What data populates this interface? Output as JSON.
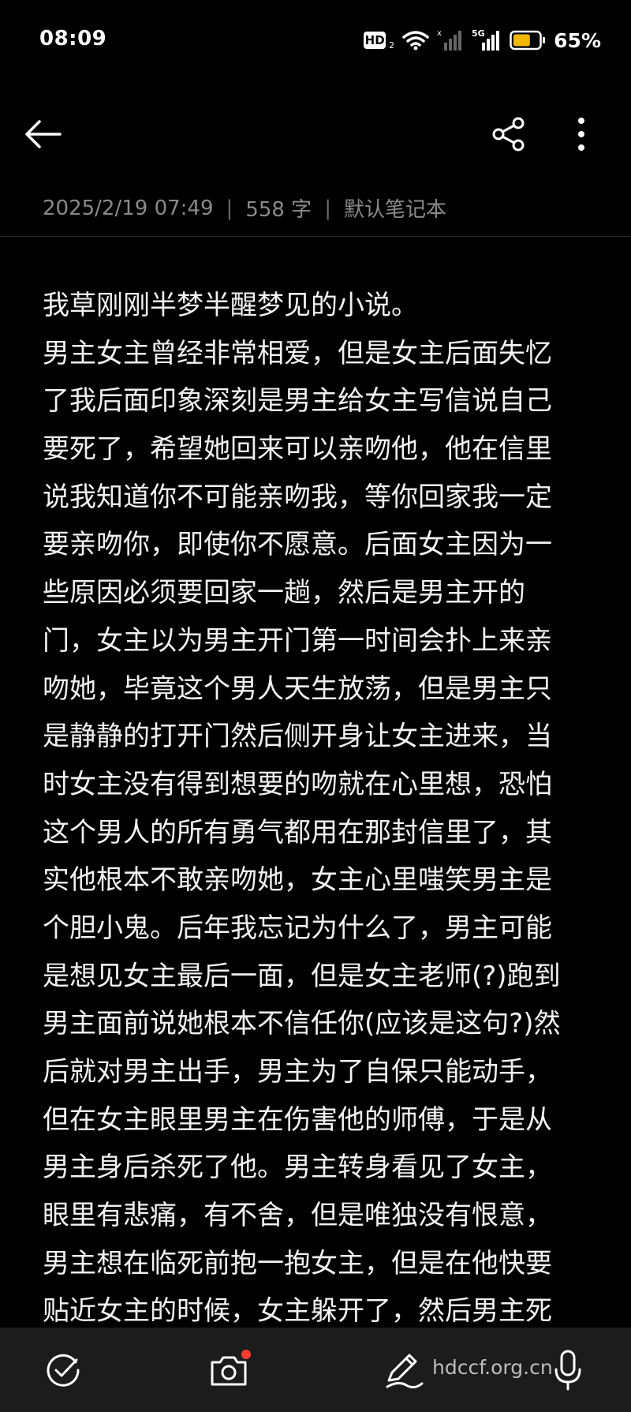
{
  "status_bar": {
    "time": "08:09",
    "hd_label": "HD",
    "hd_sub": "2",
    "signal_label": "5G",
    "battery_percent_text": "65%",
    "battery_level": 0.65,
    "battery_color": "#f2b705"
  },
  "toolbar": {
    "back_icon": "arrow-left-icon",
    "share_icon": "share-icon",
    "more_icon": "more-vertical-icon"
  },
  "meta": {
    "date": "2025/2/19 07:49",
    "separator": "|",
    "word_count": "558 字",
    "notebook": "默认笔记本"
  },
  "note": {
    "lines": [
      "我草刚刚半梦半醒梦见的小说。",
      "男主女主曾经非常相爱，但是女主后面失忆",
      "了我后面印象深刻是男主给女主写信说自己",
      "要死了，希望她回来可以亲吻他，他在信里",
      "说我知道你不可能亲吻我，等你回家我一定",
      "要亲吻你，即使你不愿意。后面女主因为一",
      "些原因必须要回家一趟，然后是男主开的",
      "门，女主以为男主开门第一时间会扑上来亲",
      "吻她，毕竟这个男人天生放荡，但是男主只",
      "是静静的打开门然后侧开身让女主进来，当",
      "时女主没有得到想要的吻就在心里想，恐怕",
      "这个男人的所有勇气都用在那封信里了，其",
      "实他根本不敢亲吻她，女主心里嗤笑男主是",
      "个胆小鬼。后年我忘记为什么了，男主可能",
      "是想见女主最后一面，但是女主老师(?)跑到",
      "男主面前说她根本不信任你(应该是这句?)然",
      "后就对男主出手，男主为了自保只能动手，",
      "但在女主眼里男主在伤害他的师傅，于是从",
      "男主身后杀死了他。男主转身看见了女主，",
      "眼里有悲痛，有不舍，但是唯独没有恨意，",
      "男主想在临死前抱一抱女主，但是在他快要",
      "贴近女主的时候，女主躲开了，然后男主死"
    ]
  },
  "bottom_bar": {
    "items": [
      {
        "icon": "check-circle-icon"
      },
      {
        "icon": "camera-icon"
      },
      {
        "icon": "pen-icon"
      },
      {
        "icon": "microphone-icon"
      }
    ],
    "watermark": "hdccf.org.cn",
    "notification_dot_color": "#ff3b30"
  }
}
